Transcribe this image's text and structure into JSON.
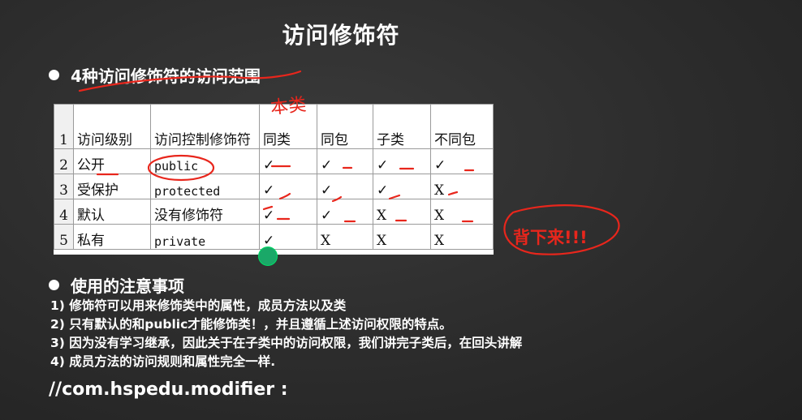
{
  "slide": {
    "title": "访问修饰符",
    "section1_heading": "4种访问修饰符的访问范围",
    "section2_heading": "使用的注意事项",
    "notes": [
      "1) 修饰符可以用来修饰类中的属性，成员方法以及类",
      "2) 只有默认的和public才能修饰类！，并且遵循上述访问权限的特点。",
      "3) 因为没有学习继承，因此关于在子类中的访问权限，我们讲完子类后，在回头讲解",
      "4) 成员方法的访问规则和属性完全一样."
    ],
    "package_line": "//com.hspedu.modifier :"
  },
  "table": {
    "headers": [
      "访问级别",
      "访问控制修饰符",
      "同类",
      "同包",
      "子类",
      "不同包"
    ],
    "rows": [
      {
        "num": "2",
        "level": "公开",
        "modifier": "public",
        "same_class": "✓",
        "same_package": "✓",
        "subclass": "✓",
        "other_package": "✓"
      },
      {
        "num": "3",
        "level": "受保护",
        "modifier": "protected",
        "same_class": "✓",
        "same_package": "✓",
        "subclass": "✓",
        "other_package": "X"
      },
      {
        "num": "4",
        "level": "默认",
        "modifier": "没有修饰符",
        "same_class": "✓",
        "same_package": "✓",
        "subclass": "X",
        "other_package": "X"
      },
      {
        "num": "5",
        "level": "私有",
        "modifier": "private",
        "same_class": "✓",
        "same_package": "X",
        "subclass": "X",
        "other_package": "X"
      }
    ],
    "header_num": "1"
  },
  "annotations": {
    "handwritten_over_col": "本类",
    "memorize_note": "背下来!!!"
  },
  "colors": {
    "ink": "#e8261c",
    "background": "#2e2e2e",
    "cursor": "#1aa868"
  }
}
